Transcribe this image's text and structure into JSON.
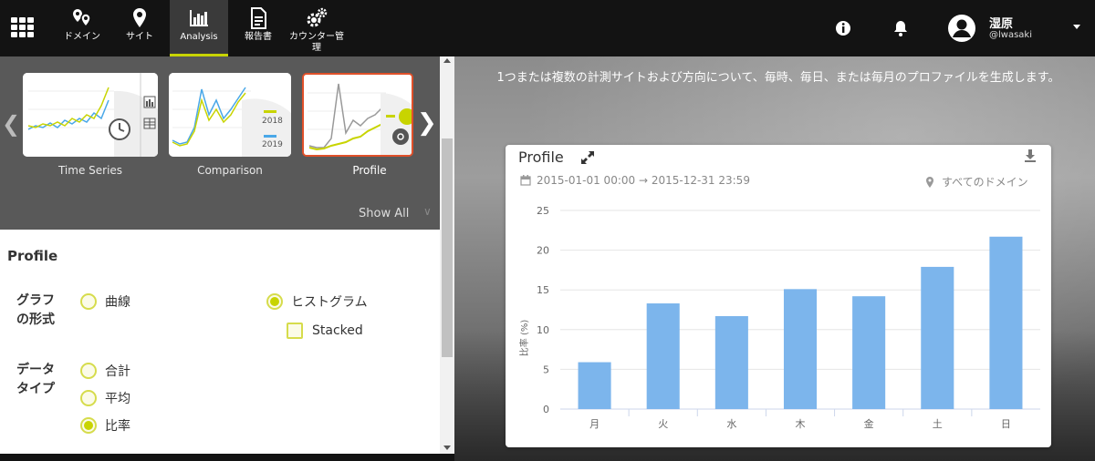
{
  "nav": {
    "items": [
      {
        "label": "ドメイン",
        "icon": "map-pins-icon"
      },
      {
        "label": "サイト",
        "icon": "map-pin-icon"
      },
      {
        "label": "Analysis",
        "icon": "bar-chart-icon",
        "active": true
      },
      {
        "label": "報告書",
        "icon": "document-icon"
      },
      {
        "label": "カウンター管理",
        "icon": "gears-icon"
      }
    ],
    "user": {
      "name": "湿原",
      "handle": "@lwasaki"
    },
    "accent_color": "#c8d400"
  },
  "gallery": {
    "thumbnails": [
      {
        "label": "Time Series"
      },
      {
        "label": "Comparison",
        "legend": [
          "2018",
          "2019"
        ]
      },
      {
        "label": "Profile",
        "selected": true
      }
    ],
    "show_all": "Show All"
  },
  "form": {
    "title": "Profile",
    "graph_type_label": "グラフの形式",
    "graph_type_line1": "グラフ",
    "graph_type_line2": "の形式",
    "graph_type_options": {
      "curve": "曲線",
      "histogram": "ヒストグラム",
      "stacked": "Stacked"
    },
    "graph_type_selected": "histogram",
    "data_type_line1": "データ",
    "data_type_line2": "タイプ",
    "data_type_options": {
      "total": "合計",
      "average": "平均",
      "ratio": "比率"
    },
    "data_type_selected": "ratio"
  },
  "main": {
    "description": "1つまたは複数の計測サイトおよび方向について、毎時、毎日、または毎月のプロファイルを生成します。",
    "card": {
      "title": "Profile",
      "date_range": "2015-01-01 00:00 → 2015-12-31 23:59",
      "domain_filter": "すべてのドメイン"
    }
  },
  "chart_data": {
    "type": "bar",
    "categories": [
      "月",
      "火",
      "水",
      "木",
      "金",
      "土",
      "日"
    ],
    "values": [
      5.9,
      13.3,
      11.7,
      15.1,
      14.2,
      17.9,
      21.7
    ],
    "ylabel": "比率 (%)",
    "ylim": [
      0,
      25
    ],
    "yticks": [
      "0",
      "5",
      "10",
      "15",
      "20",
      "25"
    ],
    "grid": true,
    "bar_color": "#7cb5ec"
  }
}
